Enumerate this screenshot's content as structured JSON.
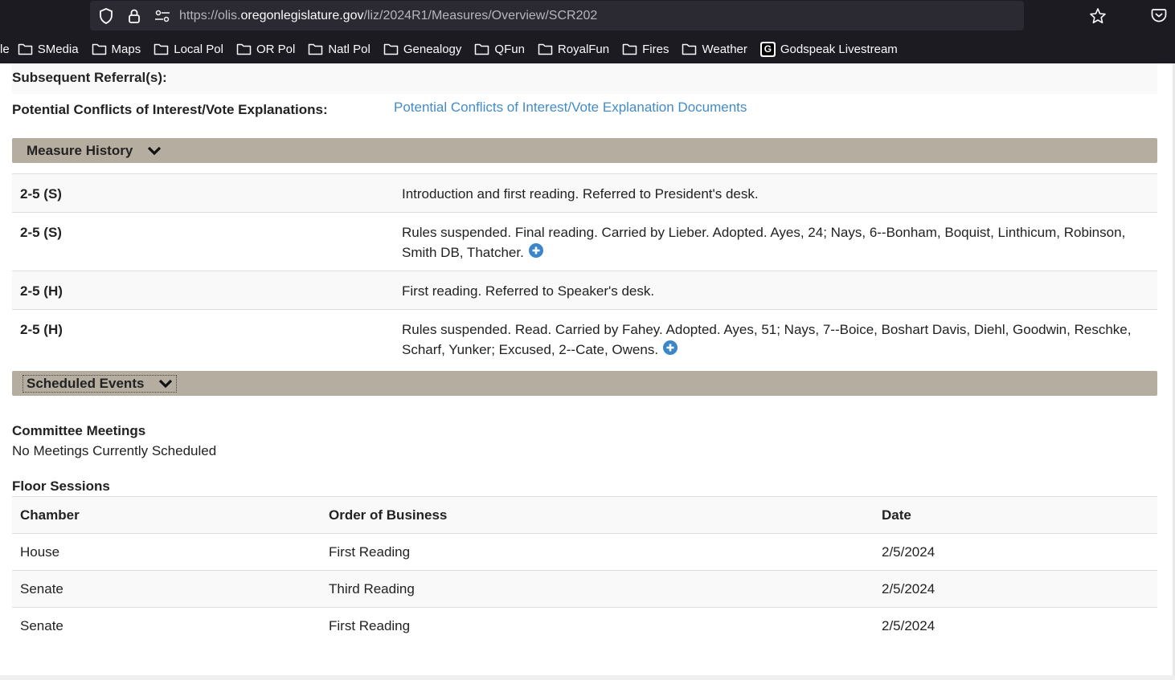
{
  "browser": {
    "url_prefix": "https://olis.",
    "url_host": "oregonlegislature.gov",
    "url_path": "/liz/2024R1/Measures/Overview/SCR202",
    "bookmarks": [
      {
        "label": "le",
        "icon": "none"
      },
      {
        "label": "SMedia",
        "icon": "folder-icon"
      },
      {
        "label": "Maps",
        "icon": "folder-icon"
      },
      {
        "label": "Local Pol",
        "icon": "folder-icon"
      },
      {
        "label": "OR Pol",
        "icon": "folder-icon"
      },
      {
        "label": "Natl Pol",
        "icon": "folder-icon"
      },
      {
        "label": "Genealogy",
        "icon": "folder-icon"
      },
      {
        "label": "QFun",
        "icon": "folder-icon"
      },
      {
        "label": "RoyalFun",
        "icon": "folder-icon"
      },
      {
        "label": "Fires",
        "icon": "folder-icon"
      },
      {
        "label": "Weather",
        "icon": "folder-icon"
      },
      {
        "label": "Godspeak Livestream",
        "icon": "g-site-icon"
      }
    ]
  },
  "details": {
    "subsequent_referrals_label": "Subsequent Referral(s):",
    "conflicts_label": "Potential Conflicts of Interest/Vote Explanations:",
    "conflicts_link": "Potential Conflicts of Interest/Vote Explanation Documents"
  },
  "measure_history": {
    "title": "Measure History",
    "rows": [
      {
        "date": "2-5 (S)",
        "action": "Introduction and first reading. Referred to President's desk.",
        "expand": false
      },
      {
        "date": "2-5 (S)",
        "action": "Rules suspended. Final reading. Carried by Lieber. Adopted. Ayes, 24; Nays, 6--Bonham, Boquist, Linthicum, Robinson, Smith DB, Thatcher.",
        "expand": true
      },
      {
        "date": "2-5 (H)",
        "action": "First reading. Referred to Speaker's desk.",
        "expand": false
      },
      {
        "date": "2-5 (H)",
        "action": "Rules suspended. Read. Carried by Fahey. Adopted. Ayes, 51; Nays, 7--Boice, Boshart Davis, Diehl, Goodwin, Reschke, Scharf, Yunker; Excused, 2--Cate, Owens.",
        "expand": true
      }
    ]
  },
  "scheduled_events": {
    "title": "Scheduled Events",
    "committee_heading": "Committee Meetings",
    "committee_text": "No Meetings Currently Scheduled",
    "floor_heading": "Floor Sessions",
    "columns": [
      "Chamber",
      "Order of Business",
      "Date"
    ],
    "rows": [
      [
        "House",
        "First Reading",
        "2/5/2024"
      ],
      [
        "Senate",
        "Third Reading",
        "2/5/2024"
      ],
      [
        "Senate",
        "First Reading",
        "2/5/2024"
      ]
    ]
  },
  "colors": {
    "section_bar": "#b5ada0",
    "link": "#428bca",
    "plus_icon": "#3a86c8"
  }
}
